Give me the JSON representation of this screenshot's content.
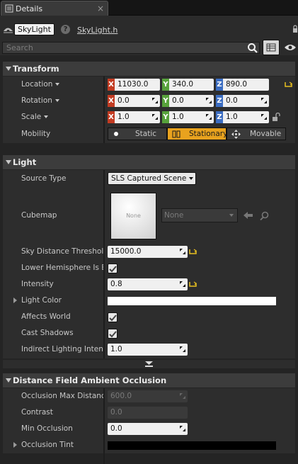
{
  "tab": {
    "title": "Details"
  },
  "header": {
    "object_name": "SkyLight",
    "source_link": "SkyLight.h"
  },
  "search": {
    "placeholder": "Search"
  },
  "transform": {
    "title": "Transform",
    "location": {
      "label": "Location",
      "x": "11030.0",
      "y": "340.0",
      "z": "890.0"
    },
    "rotation": {
      "label": "Rotation",
      "x": "0.0",
      "y": "0.0",
      "z": "0.0"
    },
    "scale": {
      "label": "Scale",
      "x": "1.0",
      "y": "1.0",
      "z": "1.0"
    },
    "mobility": {
      "label": "Mobility",
      "options": [
        "Static",
        "Stationary",
        "Movable"
      ],
      "selected": "Stationary"
    }
  },
  "light": {
    "title": "Light",
    "source_type": {
      "label": "Source Type",
      "value": "SLS Captured Scene"
    },
    "cubemap": {
      "label": "Cubemap",
      "thumbnail_text": "None",
      "value": "None"
    },
    "sky_distance": {
      "label": "Sky Distance Threshold",
      "value": "15000.0"
    },
    "lower_hemisphere": {
      "label": "Lower Hemisphere Is Black",
      "checked": true
    },
    "intensity": {
      "label": "Intensity",
      "value": "0.8"
    },
    "light_color": {
      "label": "Light Color",
      "color": "#ffffff"
    },
    "affects_world": {
      "label": "Affects World",
      "checked": true
    },
    "cast_shadows": {
      "label": "Cast Shadows",
      "checked": true
    },
    "indirect_intensity": {
      "label": "Indirect Lighting Intensity",
      "value": "1.0"
    }
  },
  "dfao": {
    "title": "Distance Field Ambient Occlusion",
    "occlusion_max_distance": {
      "label": "Occlusion Max Distance",
      "value": "600.0"
    },
    "contrast": {
      "label": "Contrast",
      "value": "0.0"
    },
    "min_occlusion": {
      "label": "Min Occlusion",
      "value": "0.0"
    },
    "occlusion_tint": {
      "label": "Occlusion Tint",
      "color": "#000000"
    }
  },
  "colors": {
    "accent": "#e8a21e",
    "axis_x": "#c23b22",
    "axis_y": "#57a23b",
    "axis_z": "#3b6dc2"
  }
}
